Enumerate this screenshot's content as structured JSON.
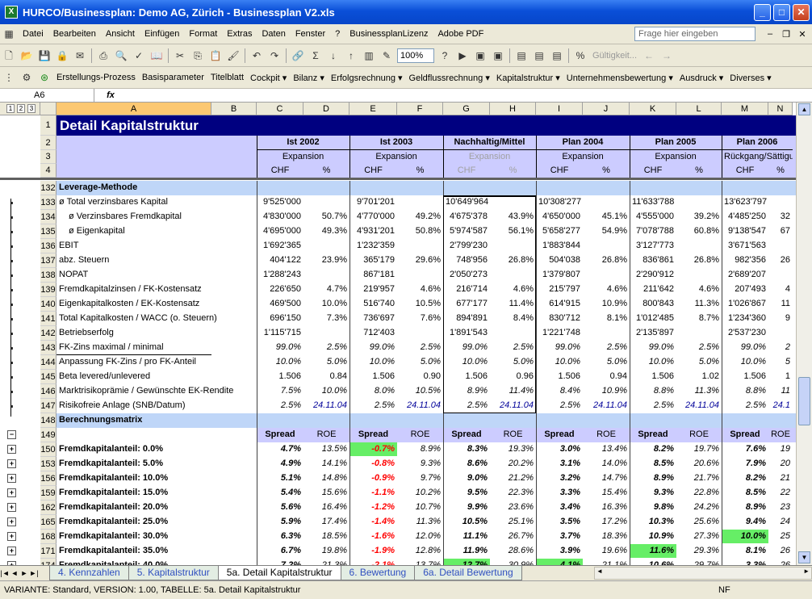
{
  "window": {
    "title": "HURCO/Businessplan: Demo AG, Zürich - Businessplan V2.xls",
    "app_icon": "X"
  },
  "menu": {
    "items": [
      {
        "label": "Datei"
      },
      {
        "label": "Bearbeiten"
      },
      {
        "label": "Ansicht"
      },
      {
        "label": "Einfügen"
      },
      {
        "label": "Format"
      },
      {
        "label": "Extras"
      },
      {
        "label": "Daten"
      },
      {
        "label": "Fenster"
      },
      {
        "label": "?"
      },
      {
        "label": "BusinessplanLizenz"
      },
      {
        "label": "Adobe PDF"
      }
    ],
    "help_placeholder": "Frage hier eingeben"
  },
  "toolbar": {
    "zoom": "100%",
    "gueltigkeit": "Gültigkeit..."
  },
  "custom_toolbar": {
    "items": [
      "Erstellungs-Prozess",
      "Basisparameter",
      "Titelblatt",
      "Cockpit ▾",
      "Bilanz ▾",
      "Erfolgsrechnung ▾",
      "Geldflussrechnung ▾",
      "Kapitalstruktur ▾",
      "Unternehmensbewertung ▾",
      "Ausdruck ▾",
      "Diverses ▾"
    ]
  },
  "formula": {
    "name_box": "A6",
    "fx": "fx",
    "value": ""
  },
  "outline_levels": [
    "1",
    "2",
    "3"
  ],
  "columns": [
    {
      "label": "A",
      "w": 192
    },
    {
      "label": "B",
      "w": 56
    },
    {
      "label": "C",
      "w": 58
    },
    {
      "label": "D",
      "w": 57
    },
    {
      "label": "E",
      "w": 59
    },
    {
      "label": "F",
      "w": 57
    },
    {
      "label": "G",
      "w": 58
    },
    {
      "label": "H",
      "w": 57
    },
    {
      "label": "I",
      "w": 58
    },
    {
      "label": "J",
      "w": 58
    },
    {
      "label": "K",
      "w": 58
    },
    {
      "label": "L",
      "w": 56
    },
    {
      "label": "M",
      "w": 58
    },
    {
      "label": "N",
      "w": 30
    }
  ],
  "sheet": {
    "title": "Detail Kapitalstruktur",
    "periods": [
      "Ist 2002",
      "Ist 2003",
      "Nachhaltig/Mittel",
      "Plan 2004",
      "Plan 2005",
      "Plan 2006"
    ],
    "phases": [
      "Expansion",
      "Expansion",
      "Expansion",
      "Expansion",
      "Expansion",
      "Rückgang/Sättigu"
    ],
    "unit_chf": "CHF",
    "unit_pct": "%",
    "section_leverage": "Leverage-Methode",
    "section_matrix": "Berechnungsmatrix",
    "spread_label": "Spread",
    "roe_label": "ROE"
  },
  "rows": [
    {
      "n": "132",
      "kind": "section",
      "label": "Leverage-Methode"
    },
    {
      "n": "133",
      "label": "ø Total verzinsbares Kapital",
      "v": [
        "9'525'000",
        "",
        "9'701'201",
        "",
        "10'649'964",
        "",
        "10'308'277",
        "",
        "11'633'788",
        "",
        "13'623'797",
        ""
      ]
    },
    {
      "n": "134",
      "label": "ø Verzinsbares Fremdkapital",
      "indent": true,
      "v": [
        "4'830'000",
        "50.7%",
        "4'770'000",
        "49.2%",
        "4'675'378",
        "43.9%",
        "4'650'000",
        "45.1%",
        "4'555'000",
        "39.2%",
        "4'485'250",
        "32"
      ]
    },
    {
      "n": "135",
      "label": "ø Eigenkapital",
      "indent": true,
      "v": [
        "4'695'000",
        "49.3%",
        "4'931'201",
        "50.8%",
        "5'974'587",
        "56.1%",
        "5'658'277",
        "54.9%",
        "7'078'788",
        "60.8%",
        "9'138'547",
        "67"
      ]
    },
    {
      "n": "136",
      "label": "EBIT",
      "v": [
        "1'692'365",
        "",
        "1'232'359",
        "",
        "2'799'230",
        "",
        "1'883'844",
        "",
        "3'127'773",
        "",
        "3'671'563",
        ""
      ]
    },
    {
      "n": "137",
      "label": "abz. Steuern",
      "v": [
        "404'122",
        "23.9%",
        "365'179",
        "29.6%",
        "748'956",
        "26.8%",
        "504'038",
        "26.8%",
        "836'861",
        "26.8%",
        "982'356",
        "26"
      ]
    },
    {
      "n": "138",
      "label": "NOPAT",
      "v": [
        "1'288'243",
        "",
        "867'181",
        "",
        "2'050'273",
        "",
        "1'379'807",
        "",
        "2'290'912",
        "",
        "2'689'207",
        ""
      ]
    },
    {
      "n": "139",
      "label": "Fremdkapitalzinsen / FK-Kostensatz",
      "v": [
        "226'650",
        "4.7%",
        "219'957",
        "4.6%",
        "216'714",
        "4.6%",
        "215'797",
        "4.6%",
        "211'642",
        "4.6%",
        "207'493",
        "4"
      ]
    },
    {
      "n": "140",
      "label": "Eigenkapitalkosten / EK-Kostensatz",
      "v": [
        "469'500",
        "10.0%",
        "516'740",
        "10.5%",
        "677'177",
        "11.4%",
        "614'915",
        "10.9%",
        "800'843",
        "11.3%",
        "1'026'867",
        "11"
      ]
    },
    {
      "n": "141",
      "label": "Total Kapitalkosten / WACC (o. Steuern)",
      "v": [
        "696'150",
        "7.3%",
        "736'697",
        "7.6%",
        "894'891",
        "8.4%",
        "830'712",
        "8.1%",
        "1'012'485",
        "8.7%",
        "1'234'360",
        "9"
      ]
    },
    {
      "n": "142",
      "label": "Betriebserfolg",
      "v": [
        "1'115'715",
        "",
        "712'403",
        "",
        "1'891'543",
        "",
        "1'221'748",
        "",
        "2'135'897",
        "",
        "2'537'230",
        ""
      ]
    },
    {
      "n": "143",
      "label": "FK-Zins maximal / minimal",
      "italic": true,
      "v": [
        "99.0%",
        "2.5%",
        "99.0%",
        "2.5%",
        "99.0%",
        "2.5%",
        "99.0%",
        "2.5%",
        "99.0%",
        "2.5%",
        "99.0%",
        "2"
      ]
    },
    {
      "n": "144",
      "label": "Anpassung FK-Zins / pro FK-Anteil",
      "italic": true,
      "v": [
        "10.0%",
        "5.0%",
        "10.0%",
        "5.0%",
        "10.0%",
        "5.0%",
        "10.0%",
        "5.0%",
        "10.0%",
        "5.0%",
        "10.0%",
        "5"
      ]
    },
    {
      "n": "145",
      "label": "Beta levered/unlevered",
      "v": [
        "1.506",
        "0.84",
        "1.506",
        "0.90",
        "1.506",
        "0.96",
        "1.506",
        "0.94",
        "1.506",
        "1.02",
        "1.506",
        "1"
      ]
    },
    {
      "n": "146",
      "label": "Marktrisikoprämie / Gewünschte EK-Rendite",
      "italic": true,
      "v": [
        "7.5%",
        "10.0%",
        "8.0%",
        "10.5%",
        "8.9%",
        "11.4%",
        "8.4%",
        "10.9%",
        "8.8%",
        "11.3%",
        "8.8%",
        "11"
      ]
    },
    {
      "n": "147",
      "label": "Risikofreie Anlage (SNB/Datum)",
      "italic": true,
      "v": [
        "2.5%",
        "24.11.04",
        "2.5%",
        "24.11.04",
        "2.5%",
        "24.11.04",
        "2.5%",
        "24.11.04",
        "2.5%",
        "24.11.04",
        "2.5%",
        "24.1"
      ]
    },
    {
      "n": "148",
      "kind": "section",
      "label": "Berechnungsmatrix"
    },
    {
      "n": "149",
      "kind": "spreadhdr",
      "label": ""
    },
    {
      "n": "150",
      "kind": "matrix",
      "label": "Fremdkapitalanteil: 0.0%",
      "v": [
        "4.7%",
        "13.5%",
        "-0.7%",
        "8.9%",
        "8.3%",
        "19.3%",
        "3.0%",
        "13.4%",
        "8.2%",
        "19.7%",
        "7.6%",
        "19"
      ]
    },
    {
      "n": "153",
      "kind": "matrix",
      "label": "Fremdkapitalanteil: 5.0%",
      "v": [
        "4.9%",
        "14.1%",
        "-0.8%",
        "9.3%",
        "8.6%",
        "20.2%",
        "3.1%",
        "14.0%",
        "8.5%",
        "20.6%",
        "7.9%",
        "20"
      ]
    },
    {
      "n": "156",
      "kind": "matrix",
      "label": "Fremdkapitalanteil: 10.0%",
      "v": [
        "5.1%",
        "14.8%",
        "-0.9%",
        "9.7%",
        "9.0%",
        "21.2%",
        "3.2%",
        "14.7%",
        "8.9%",
        "21.7%",
        "8.2%",
        "21"
      ]
    },
    {
      "n": "159",
      "kind": "matrix",
      "label": "Fremdkapitalanteil: 15.0%",
      "v": [
        "5.4%",
        "15.6%",
        "-1.1%",
        "10.2%",
        "9.5%",
        "22.3%",
        "3.3%",
        "15.4%",
        "9.3%",
        "22.8%",
        "8.5%",
        "22"
      ]
    },
    {
      "n": "162",
      "kind": "matrix",
      "label": "Fremdkapitalanteil: 20.0%",
      "v": [
        "5.6%",
        "16.4%",
        "-1.2%",
        "10.7%",
        "9.9%",
        "23.6%",
        "3.4%",
        "16.3%",
        "9.8%",
        "24.2%",
        "8.9%",
        "23"
      ]
    },
    {
      "n": "165",
      "kind": "matrix",
      "label": "Fremdkapitalanteil: 25.0%",
      "v": [
        "5.9%",
        "17.4%",
        "-1.4%",
        "11.3%",
        "10.5%",
        "25.1%",
        "3.5%",
        "17.2%",
        "10.3%",
        "25.6%",
        "9.4%",
        "24"
      ]
    },
    {
      "n": "168",
      "kind": "matrix",
      "label": "Fremdkapitalanteil: 30.0%",
      "v": [
        "6.3%",
        "18.5%",
        "-1.6%",
        "12.0%",
        "11.1%",
        "26.7%",
        "3.7%",
        "18.3%",
        "10.9%",
        "27.3%",
        "10.0%",
        "25"
      ]
    },
    {
      "n": "171",
      "kind": "matrix",
      "label": "Fremdkapitalanteil: 35.0%",
      "v": [
        "6.7%",
        "19.8%",
        "-1.9%",
        "12.8%",
        "11.9%",
        "28.6%",
        "3.9%",
        "19.6%",
        "11.6%",
        "29.3%",
        "8.1%",
        "26"
      ]
    },
    {
      "n": "174",
      "kind": "matrix",
      "label": "Fremdkapitalanteil: 40.0%",
      "v": [
        "7.2%",
        "21.3%",
        "-2.1%",
        "13.7%",
        "12.7%",
        "30.9%",
        "4.1%",
        "21.1%",
        "10.6%",
        "29.7%",
        "3.3%",
        "26"
      ]
    }
  ],
  "highlights": [
    {
      "row": "150",
      "col": 2
    },
    {
      "row": "168",
      "col": 10
    },
    {
      "row": "171",
      "col": 8
    },
    {
      "row": "174",
      "col": 4
    },
    {
      "row": "174",
      "col": 6
    }
  ],
  "tabs": [
    {
      "label": "4. Kennzahlen",
      "active": false
    },
    {
      "label": "5. Kapitalstruktur",
      "active": false
    },
    {
      "label": "5a. Detail Kapitalstruktur",
      "active": true
    },
    {
      "label": "6. Bewertung",
      "active": false
    },
    {
      "label": "6a. Detail Bewertung",
      "active": false
    }
  ],
  "status": {
    "text": "VARIANTE: Standard, VERSION: 1.00, TABELLE: 5a. Detail Kapitalstruktur",
    "indicator": "NF"
  }
}
